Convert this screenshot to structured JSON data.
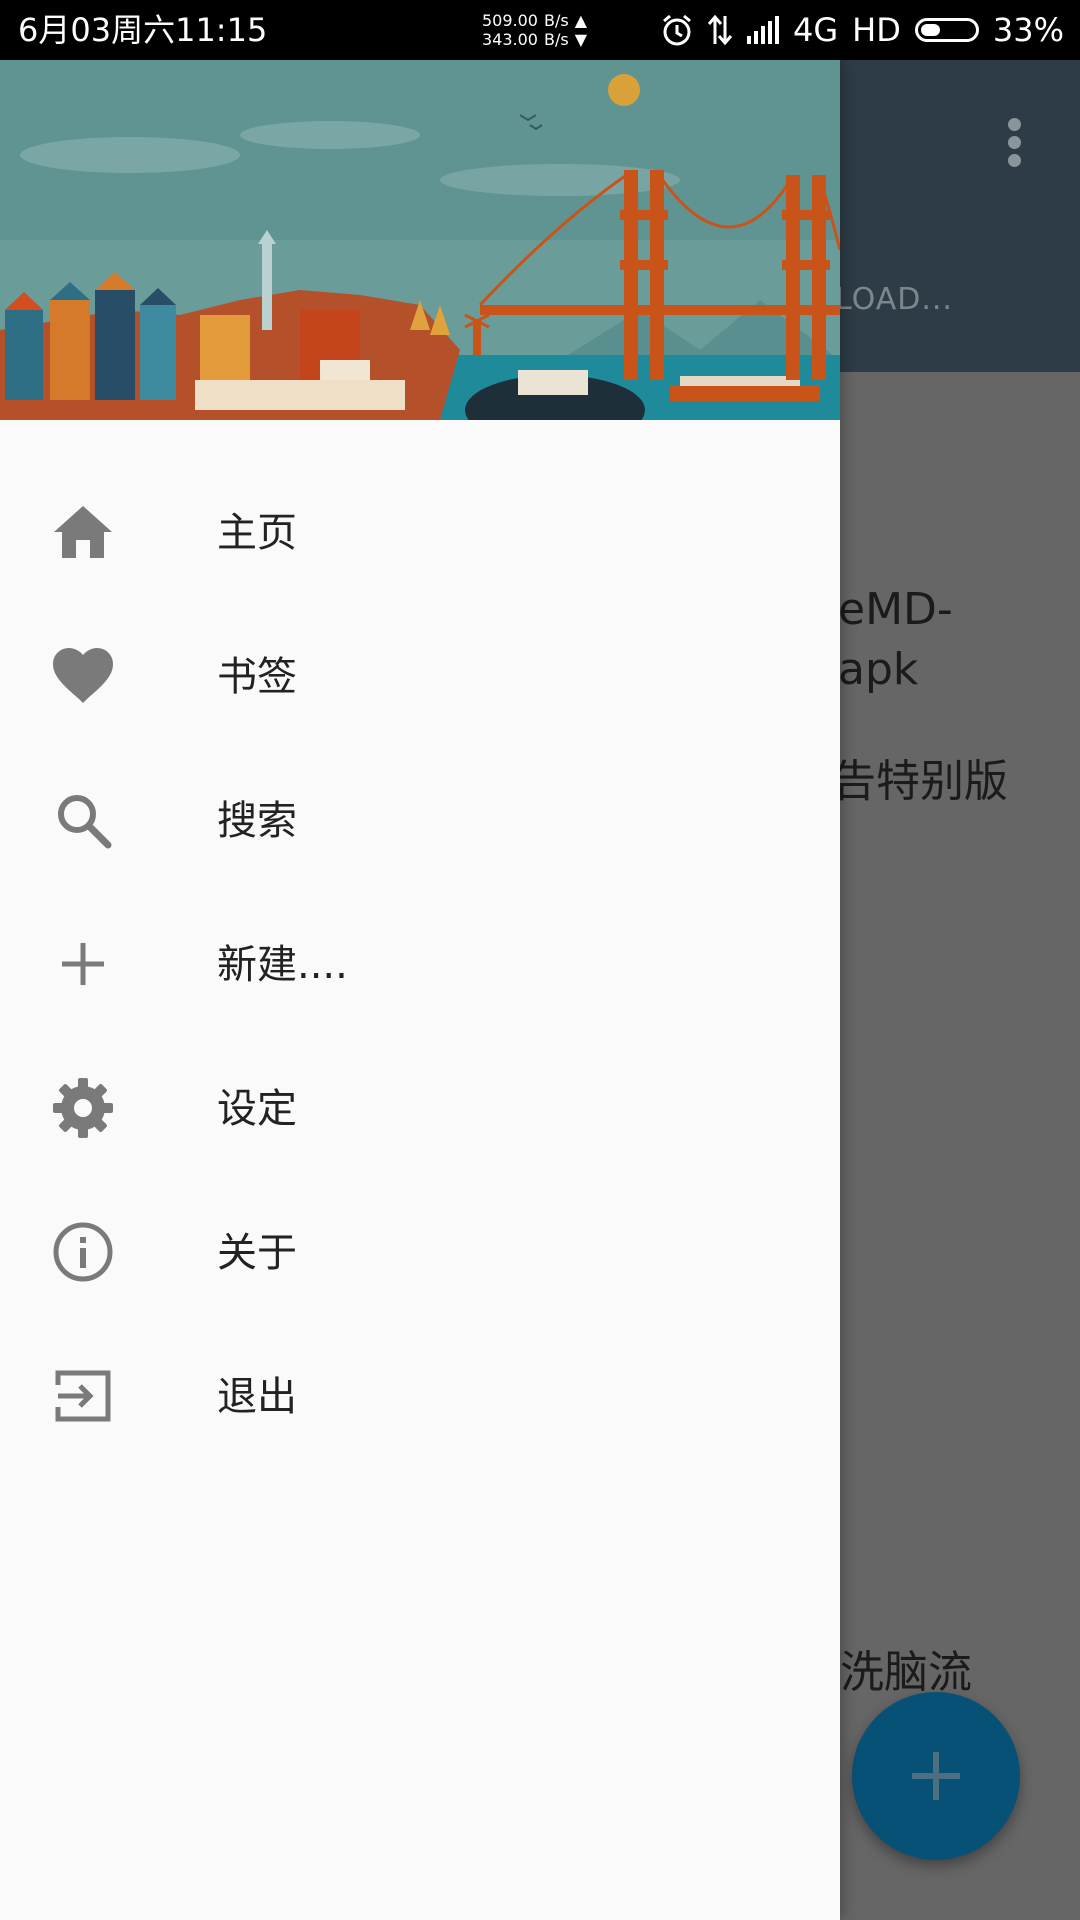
{
  "status_bar": {
    "time": "6月03周六11:15",
    "upload_speed": "509.00",
    "download_speed": "343.00",
    "speed_unit": "B/s",
    "upload_arrow": "▲",
    "download_arrow": "▼",
    "network": "4G",
    "hd": "HD",
    "battery": "33%",
    "battery_level": 0.33
  },
  "background_app": {
    "toolbar_tab_fragment": "LOAD...",
    "title_line1": "eMD-",
    "title_line2": "apk",
    "subtitle": "告特别版",
    "footer": "洗脑流",
    "fab_icon": "plus-icon"
  },
  "drawer": {
    "header_image": "san-francisco-golden-gate-illustration",
    "menu": [
      {
        "label": "主页",
        "icon": "home-icon"
      },
      {
        "label": "书签",
        "icon": "heart-icon"
      },
      {
        "label": "搜索",
        "icon": "search-icon"
      },
      {
        "label": "新建....",
        "icon": "plus-icon"
      },
      {
        "label": "设定",
        "icon": "gear-icon"
      },
      {
        "label": "关于",
        "icon": "info-icon"
      },
      {
        "label": "退出",
        "icon": "exit-icon"
      }
    ]
  },
  "colors": {
    "icon_gray": "#7a7a7a",
    "drawer_bg": "#fafafa",
    "toolbar": "#2e3c47",
    "fab": "#075076",
    "bridge": "#c9541a",
    "sea": "#1f8a9a"
  }
}
